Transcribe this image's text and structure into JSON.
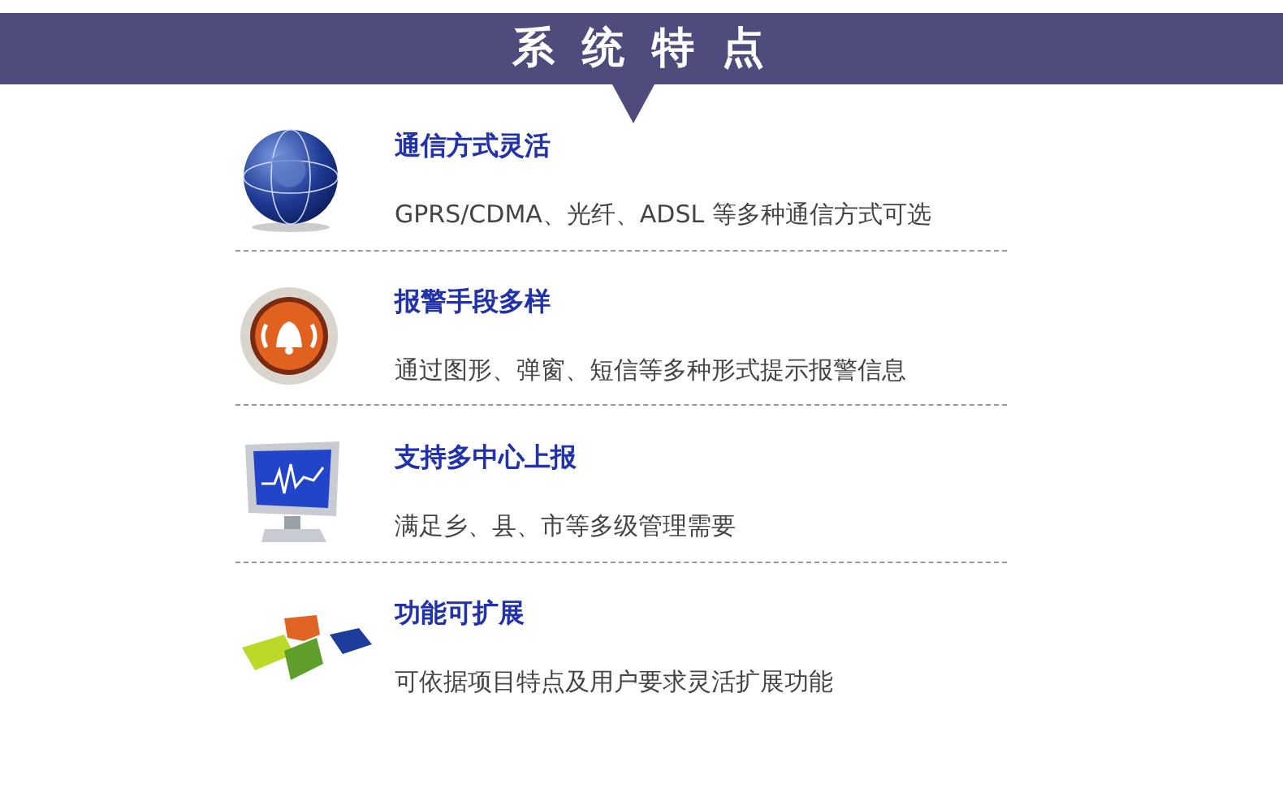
{
  "banner": {
    "title": "系 统 特 点"
  },
  "features": [
    {
      "kind": "globe",
      "title": "通信方式灵活",
      "description": "GPRS/CDMA、光纤、ADSL 等多种通信方式可选"
    },
    {
      "kind": "alarm",
      "title": "报警手段多样",
      "description": "通过图形、弹窗、短信等多种形式提示报警信息"
    },
    {
      "kind": "monitor",
      "title": "支持多中心上报",
      "description": "满足乡、县、市等多级管理需要"
    },
    {
      "kind": "puzzle",
      "title": "功能可扩展",
      "description": "可依据项目特点及用户要求灵活扩展功能"
    }
  ]
}
